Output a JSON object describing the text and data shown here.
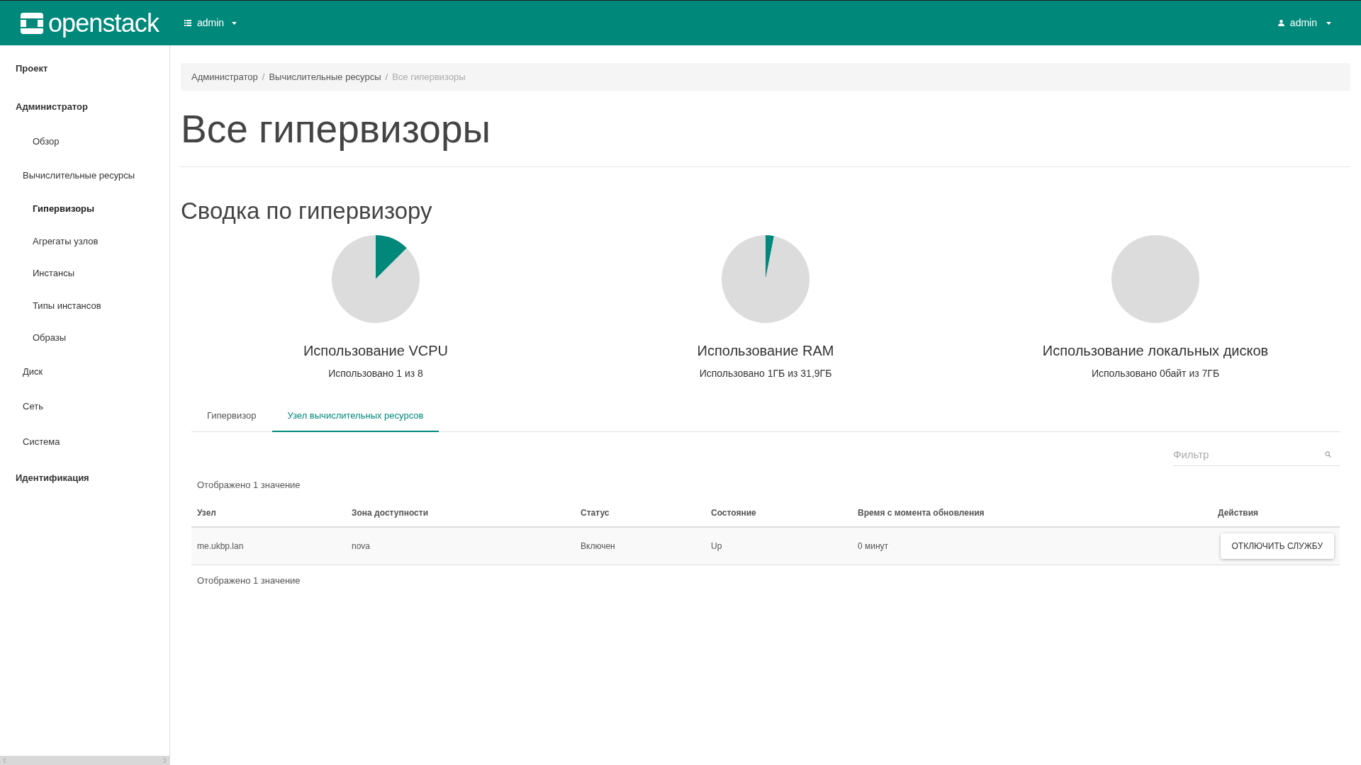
{
  "header": {
    "logo": "openstack",
    "project_menu": "admin",
    "user_menu": "admin"
  },
  "sidebar": {
    "items": [
      {
        "label": "Проект",
        "kind": "dashboard",
        "selected": false
      },
      {
        "label": "Администратор",
        "kind": "dashboard",
        "selected": false
      },
      {
        "label": "Обзор",
        "kind": "panel",
        "selected": false
      },
      {
        "label": "Вычислительные ресурсы",
        "kind": "group",
        "selected": false
      },
      {
        "label": "Гипервизоры",
        "kind": "panel",
        "selected": true
      },
      {
        "label": "Агрегаты узлов",
        "kind": "panel",
        "selected": false
      },
      {
        "label": "Инстансы",
        "kind": "panel",
        "selected": false
      },
      {
        "label": "Типы инстансов",
        "kind": "panel",
        "selected": false
      },
      {
        "label": "Образы",
        "kind": "panel",
        "selected": false
      },
      {
        "label": "Диск",
        "kind": "group",
        "selected": false
      },
      {
        "label": "Сеть",
        "kind": "group",
        "selected": false
      },
      {
        "label": "Система",
        "kind": "group",
        "selected": false
      },
      {
        "label": "Идентификация",
        "kind": "dashboard",
        "selected": false
      }
    ]
  },
  "breadcrumb": {
    "separator": "/",
    "items": [
      "Администратор",
      "Вычислительные ресурсы",
      "Все гипервизоры"
    ]
  },
  "page_title": "Все гипервизоры",
  "summary": {
    "title": "Сводка по гипервизору",
    "gauges": [
      {
        "label": "Использование VCPU",
        "reading": "Использовано 1 из 8",
        "chart_data": {
          "type": "pie",
          "values": [
            12.5,
            87.5
          ],
          "colors": [
            "#00897b",
            "#dcdcdc"
          ]
        }
      },
      {
        "label": "Использование RAM",
        "reading": "Использовано 1ГБ из 31,9ГБ",
        "chart_data": {
          "type": "pie",
          "values": [
            3.1,
            96.9
          ],
          "colors": [
            "#00897b",
            "#dcdcdc"
          ]
        }
      },
      {
        "label": "Использование локальных дисков",
        "reading": "Использовано 0байт из 7ГБ",
        "chart_data": {
          "type": "pie",
          "values": [
            100
          ],
          "colors": [
            "#dcdcdc"
          ]
        }
      }
    ]
  },
  "tabs": [
    {
      "label": "Гипервизор",
      "selected": false
    },
    {
      "label": "Узел вычислительных ресурсов",
      "selected": true
    }
  ],
  "filter": {
    "placeholder": "Фильтр"
  },
  "table": {
    "count_top": "Отображено 1 значение",
    "columns": [
      "Узел",
      "Зона доступности",
      "Статус",
      "Состояние",
      "Время с момента обновления",
      "Действия"
    ],
    "rows": [
      {
        "cells": [
          "me.ukbp.lan",
          "nova",
          "Включен",
          "Up",
          "0 минут"
        ],
        "action": "ОТКЛЮЧИТЬ СЛУЖБУ"
      }
    ],
    "count_bottom": "Отображено 1 значение"
  }
}
